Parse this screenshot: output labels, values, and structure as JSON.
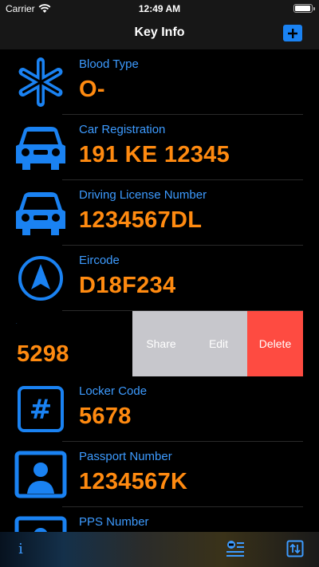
{
  "status_bar": {
    "carrier": "Carrier",
    "time": "12:49 AM",
    "battery_level": 0.9
  },
  "nav": {
    "title": "Key Info",
    "add_icon": "plus-icon"
  },
  "items": [
    {
      "label": "Blood Type",
      "value": "O-",
      "icon": "medical-star-icon"
    },
    {
      "label": "Car Registration",
      "value": "191 KE 12345",
      "icon": "car-icon"
    },
    {
      "label": "Driving License Number",
      "value": "1234567DL",
      "icon": "car-icon"
    },
    {
      "label": "Eircode",
      "value": "D18F234",
      "icon": "navigation-arrow-icon"
    },
    {
      "label": "-",
      "value": "5298",
      "icon": "none"
    },
    {
      "label": "Locker Code",
      "value": "5678",
      "icon": "hash-icon"
    },
    {
      "label": "Passport Number",
      "value": "1234567K",
      "icon": "person-card-icon"
    },
    {
      "label": "PPS Number",
      "value": "",
      "icon": "person-card-icon"
    }
  ],
  "swipe_actions": {
    "share": "Share",
    "edit": "Edit",
    "delete": "Delete"
  },
  "tab_bar": {
    "info": "i"
  },
  "colors": {
    "accent": "#3d9bff",
    "value": "#ff8a10",
    "delete": "#fe4b41",
    "action_gray": "#c7c7cc",
    "bar": "#171717"
  }
}
